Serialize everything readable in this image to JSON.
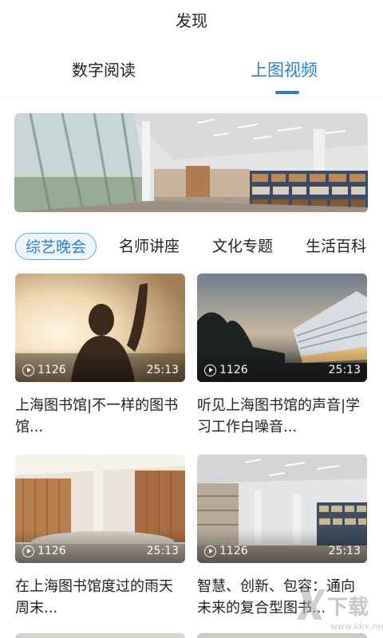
{
  "header": {
    "title": "发现"
  },
  "top_tabs": [
    {
      "label": "数字阅读",
      "active": false
    },
    {
      "label": "上图视频",
      "active": true
    }
  ],
  "accent_color": "#2f7fc1",
  "categories": [
    {
      "label": "综艺晚会",
      "active": true
    },
    {
      "label": "名师讲座",
      "active": false
    },
    {
      "label": "文化专题",
      "active": false
    },
    {
      "label": "生活百科",
      "active": false
    }
  ],
  "videos": [
    {
      "plays": "1126",
      "duration": "25:13",
      "title": "上海图书馆|不一样的图书馆..."
    },
    {
      "plays": "1126",
      "duration": "25:13",
      "title": "听见上海图书馆的声音|学习工作白噪音..."
    },
    {
      "plays": "1126",
      "duration": "25:13",
      "title": "在上海图书馆度过的雨天周末..."
    },
    {
      "plays": "1126",
      "duration": "25:13",
      "title": "智慧、创新、包容：通向未来的复合型图书..."
    }
  ],
  "watermark": {
    "text": "下载",
    "url": "www.kkx.net"
  }
}
